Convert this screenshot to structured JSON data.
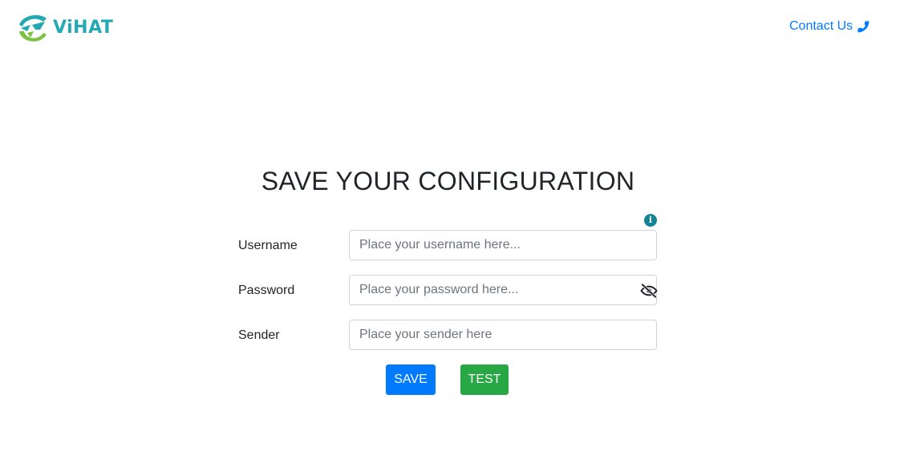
{
  "header": {
    "logo_text": "ViHAT",
    "contact_label": "Contact Us",
    "contact_icon": "phone-icon"
  },
  "form": {
    "title": "SAVE YOUR CONFIGURATION",
    "info_icon": "info-icon",
    "info_glyph": "i",
    "username": {
      "label": "Username",
      "value": "",
      "placeholder": "Place your username here..."
    },
    "password": {
      "label": "Password",
      "value": "",
      "placeholder": "Place your password here...",
      "toggle_icon": "eye-slash-icon"
    },
    "sender": {
      "label": "Sender",
      "value": "",
      "placeholder": "Place your sender here"
    },
    "save_label": "SAVE",
    "test_label": "TEST"
  },
  "colors": {
    "primary": "#007bff",
    "success": "#28a745",
    "info": "#138496",
    "brand_teal": "#22a9b4",
    "brand_green": "#7cc242"
  }
}
